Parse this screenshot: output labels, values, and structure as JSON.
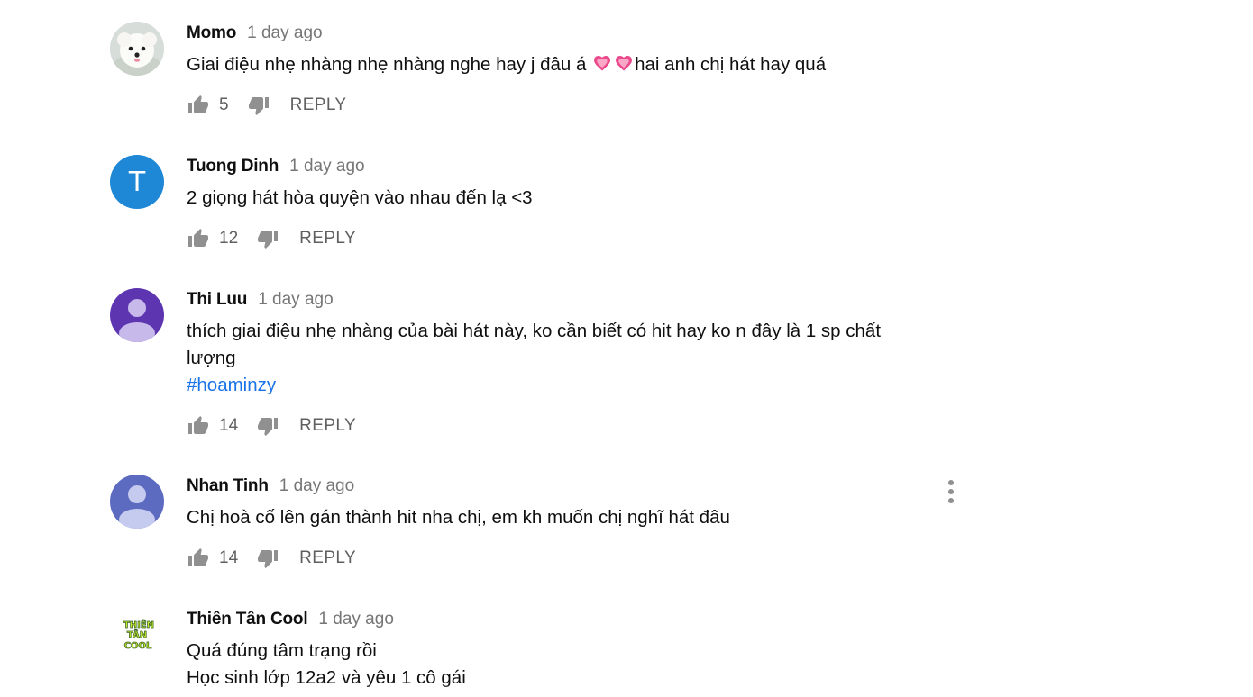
{
  "reply_label": "REPLY",
  "colors": {
    "author_text": "#0f0f0f",
    "meta_text": "#767676",
    "hashtag": "#1a73e8",
    "action_icon": "#909090"
  },
  "comments": [
    {
      "author": "Momo",
      "time": "1 day ago",
      "avatar": "pomeranian-dog-photo",
      "text_parts": [
        "Giai điệu nhẹ nhàng nhẹ nhàng nghe hay j đâu á ",
        "hai anh chị hát hay quá"
      ],
      "emoji": "heart-emoji",
      "likes": "5"
    },
    {
      "author": "Tuong Dinh",
      "time": "1 day ago",
      "avatar_letter": "T",
      "avatar_color": "#1e88d6",
      "lines": [
        "2 giọng hát hòa quyện vào nhau đến lạ <3"
      ],
      "likes": "12"
    },
    {
      "author": "Thi Luu",
      "time": "1 day ago",
      "avatar_color": "#5e35b1",
      "lines": [
        "thích giai điệu nhẹ nhàng của bài hát này, ko cần biết có hit hay ko n đây là 1 sp chất",
        "lượng"
      ],
      "hashtag": "#hoaminzy",
      "likes": "14"
    },
    {
      "author": "Nhan Tinh",
      "time": "1 day ago",
      "avatar_color": "#5c6bc0",
      "lines": [
        "Chị hoà cố lên gán thành hit nha chị, em kh muốn chị nghĩ hát đâu"
      ],
      "likes": "14",
      "menu_icon": "more-vertical-icon"
    },
    {
      "author": "Thiên Tân Cool",
      "time": "1 day ago",
      "avatar_logo_text": [
        "THIÊN",
        "TÂN",
        "COOL"
      ],
      "avatar_logo_color": "#c6e82b",
      "lines": [
        "Quá đúng tâm trạng rồi",
        "Học sinh lớp 12a2 và yêu 1 cô gái"
      ]
    }
  ]
}
